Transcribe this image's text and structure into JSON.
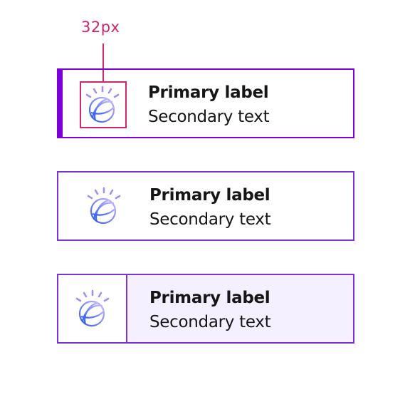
{
  "annotation": {
    "label": "32px",
    "color": "#d02670"
  },
  "cards": [
    {
      "variant": "selected",
      "primary": "Primary label",
      "secondary": "Secondary text"
    },
    {
      "variant": "default",
      "primary": "Primary label",
      "secondary": "Secondary text"
    },
    {
      "variant": "split",
      "primary": "Primary label",
      "secondary": "Secondary text"
    }
  ],
  "colors": {
    "border": "#7b32d6",
    "accent": "#7c00d9",
    "split_bg": "#f5f0ff"
  }
}
